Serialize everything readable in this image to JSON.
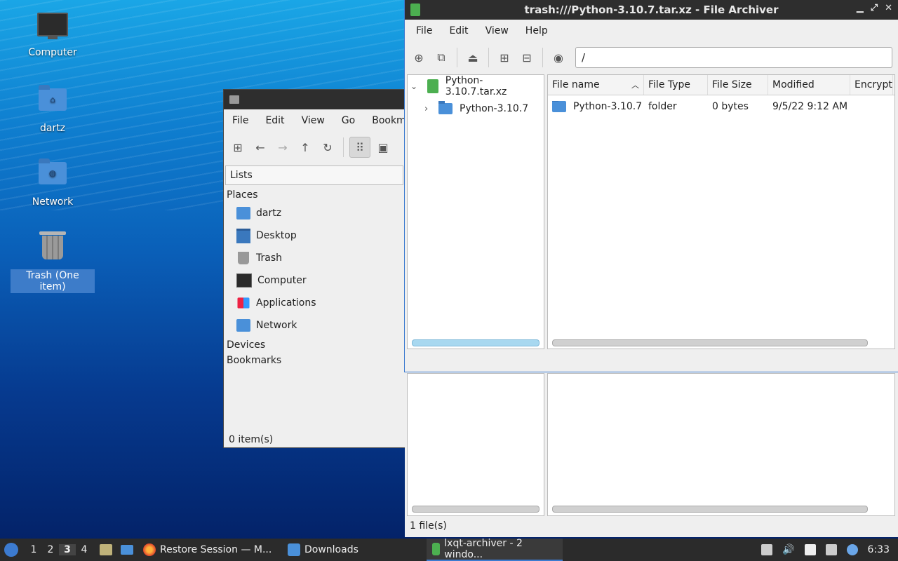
{
  "desktop": {
    "icons": [
      {
        "label": "Computer"
      },
      {
        "label": "dartz"
      },
      {
        "label": "Network"
      },
      {
        "label": "Trash (One item)"
      }
    ]
  },
  "file_manager": {
    "menu": [
      "File",
      "Edit",
      "View",
      "Go",
      "Bookmar"
    ],
    "side_selector": "Lists",
    "sections": {
      "places": "Places",
      "devices": "Devices",
      "bookmarks": "Bookmarks"
    },
    "places": [
      "dartz",
      "Desktop",
      "Trash",
      "Computer",
      "Applications",
      "Network"
    ],
    "status": "0 item(s)"
  },
  "archiver": {
    "title": "trash:///Python-3.10.7.tar.xz - File Archiver",
    "menu": [
      "File",
      "Edit",
      "View",
      "Help"
    ],
    "path": "/",
    "tree": {
      "root": "Python-3.10.7.tar.xz",
      "child": "Python-3.10.7"
    },
    "columns": [
      "File name",
      "File Type",
      "File Size",
      "Modified",
      "Encrypte"
    ],
    "rows": [
      {
        "name": "Python-3.10.7",
        "type": "folder",
        "size": "0 bytes",
        "modified": "9/5/22 9:12 AM"
      }
    ],
    "status": "1 file(s)"
  },
  "taskbar": {
    "desktops": [
      "1",
      "2",
      "3",
      "4"
    ],
    "tasks": [
      "Restore Session — M...",
      "Downloads",
      "lxqt-archiver - 2 windo..."
    ],
    "clock": "6:33"
  }
}
